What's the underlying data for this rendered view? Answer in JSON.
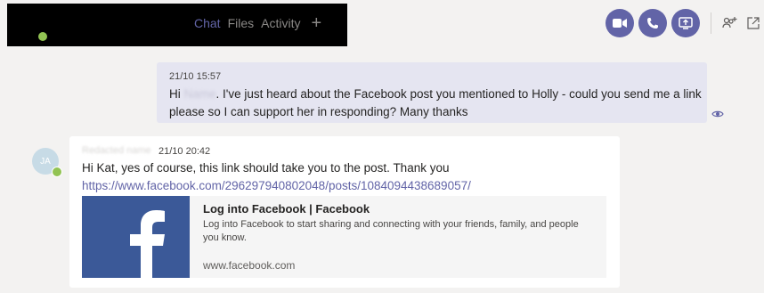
{
  "header": {
    "tabs": [
      {
        "label": "Chat",
        "active": true
      },
      {
        "label": "Files",
        "active": false
      },
      {
        "label": "Activity",
        "active": false
      }
    ],
    "add_tab_icon": "plus-icon",
    "actions": [
      "video-call-icon",
      "audio-call-icon",
      "screen-share-icon",
      "add-people-icon",
      "pop-out-icon"
    ],
    "accent_color": "#6264a7"
  },
  "messages": [
    {
      "direction": "sent",
      "timestamp": "21/10 15:57",
      "text_before": "Hi ",
      "text_redacted": "Name",
      "text_after": ". I've just heard about the Facebook post you mentioned to Holly - could you send me a link please so I can support her in responding? Many thanks",
      "read_icon": "seen-eye-icon"
    },
    {
      "direction": "received",
      "sender_redacted": "Redacted name",
      "avatar_initials": "JA",
      "timestamp": "21/10 20:42",
      "text": "Hi Kat, yes of course, this link should take you to the post. Thank you ",
      "link": "https://www.facebook.com/296297940802048/posts/1084094438689057/",
      "preview": {
        "title": "Log into Facebook | Facebook",
        "description": "Log into Facebook to start sharing and connecting with your friends, family, and people you know.",
        "domain": "www.facebook.com",
        "thumb_icon": "facebook-logo-icon",
        "thumb_color": "#3b5998"
      }
    }
  ]
}
